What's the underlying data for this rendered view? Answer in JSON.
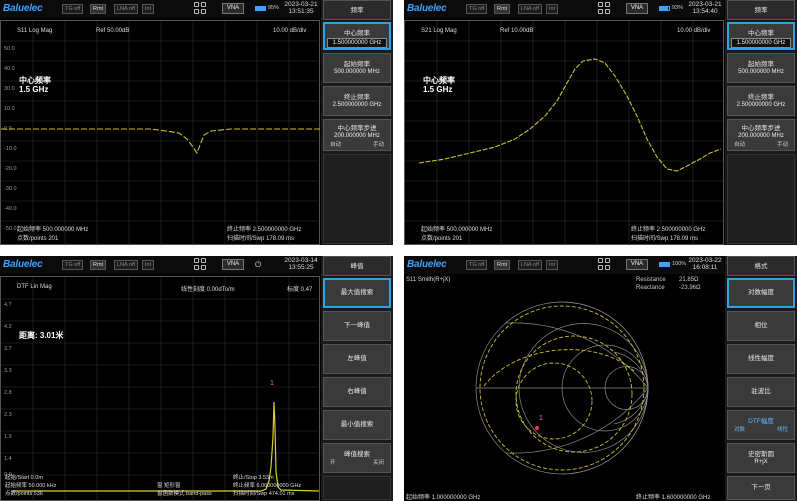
{
  "brand": "Baluelec",
  "top_buttons": [
    "TG off",
    "Rmt",
    "LNA off",
    "Int"
  ],
  "mode": "VNA",
  "panels": [
    {
      "battery": "95%",
      "date": "2023-03-21",
      "time": "13:51:35",
      "trace_label": "S11 Log Mag",
      "ref_label": "Ref 50.00dB",
      "scale_label": "10.00 dB/div",
      "marker_title": "中心频率",
      "marker_value": "1.5 GHz",
      "y_ticks": [
        "50.0",
        "40.0",
        "30.0",
        "20.0",
        "10.0",
        "0.0",
        "-10.0",
        "-20.0",
        "-30.0",
        "-40.0",
        "-50.0"
      ],
      "bottom_left_1": "起始频率 500.000000 MHz",
      "bottom_left_2": "点数/points 201",
      "bottom_right_1": "终止频率 2.500000000 GHz",
      "bottom_right_2": "扫描时间/Swp 178.09 ms",
      "menu_title": "频率",
      "menu": [
        {
          "label": "中心频率",
          "value": "1.500000000 GHz"
        },
        {
          "label": "起始频率",
          "value": "500.000000 MHz"
        },
        {
          "label": "终止频率",
          "value": "2.500000000 GHz"
        },
        {
          "label": "中心频率步进",
          "value": "200.000000 MHz",
          "opt_a": "自动",
          "opt_b": "手动"
        }
      ]
    },
    {
      "battery": "93%",
      "date": "2023-03-21",
      "time": "13:54:40",
      "trace_label": "S21 Log Mag",
      "ref_label": "Ref 10.00dB",
      "scale_label": "10.00 dB/div",
      "marker_title": "中心频率",
      "marker_value": "1.5 GHz",
      "bottom_left_1": "起始频率 500.000000 MHz",
      "bottom_left_2": "点数/points 201",
      "bottom_right_1": "终止频率 2.500000000 GHz",
      "bottom_right_2": "扫描时间/Swp 178.09 ms",
      "menu_title": "频率",
      "menu": [
        {
          "label": "中心频率",
          "value": "1.500000000 GHz"
        },
        {
          "label": "起始频率",
          "value": "500.000000 MHz"
        },
        {
          "label": "终止频率",
          "value": "2.500000000 GHz"
        },
        {
          "label": "中心频率步进",
          "value": "200.000000 MHz",
          "opt_a": "自动",
          "opt_b": "手动"
        }
      ]
    },
    {
      "date": "2023-03-14",
      "time": "13:55:25",
      "trace_label": "DTF Lin Mag",
      "ref_label": "线性刻度 0.00dTo/m",
      "scale_label": "标度 0.47",
      "marker_title": "距离: 3.01米",
      "marker_id": "1",
      "y_ticks": [
        "4.7",
        "4.2",
        "3.7",
        "3.3",
        "2.8",
        "2.3",
        "1.9",
        "1.4",
        "0.9",
        "0.5"
      ],
      "bottom_left_1": "起始/Start 0.0m",
      "bottom_left_2": "起始频率 50.000 kHz",
      "bottom_left_3": "点数/points 536",
      "bottom_mid_1": "窗 矩形窗",
      "bottom_mid_2": "窗函数模式 band-pass",
      "bottom_right_1": "终止/Stop 3.53m",
      "bottom_right_2": "终止频率 6.000000000 GHz",
      "bottom_right_3": "扫描时间/Swp 474.01 ms",
      "menu_title": "峰值",
      "menu": [
        {
          "label": "最大值搜索"
        },
        {
          "label": "下一峰值"
        },
        {
          "label": "左峰值"
        },
        {
          "label": "右峰值"
        },
        {
          "label": "最小值搜索"
        },
        {
          "label": "峰值搜索",
          "opt_a": "开",
          "opt_b": "关闭"
        }
      ]
    },
    {
      "battery": "100%",
      "date": "2023-03-22",
      "time": "16:08:11",
      "trace_label": "S11 Smith(R+jX)",
      "readout_1_label": "Resistance",
      "readout_1_value": "21.85Ω",
      "readout_2_label": "Reactance",
      "readout_2_value": "-23.96Ω",
      "marker_id": "1",
      "bottom_left": "起始频率 1.000000000 GHz",
      "bottom_right": "终止频率 1.600000000 GHz",
      "menu_title": "格式",
      "menu": [
        {
          "label": "对数幅度"
        },
        {
          "label": "相位"
        },
        {
          "label": "线性幅度"
        },
        {
          "label": "驻波比"
        },
        {
          "label": "DTF幅度",
          "opt_a": "对数",
          "opt_b": "线性"
        },
        {
          "label": "史密斯圆",
          "value": "R+jX"
        },
        {
          "label": "下一页"
        }
      ]
    }
  ]
}
